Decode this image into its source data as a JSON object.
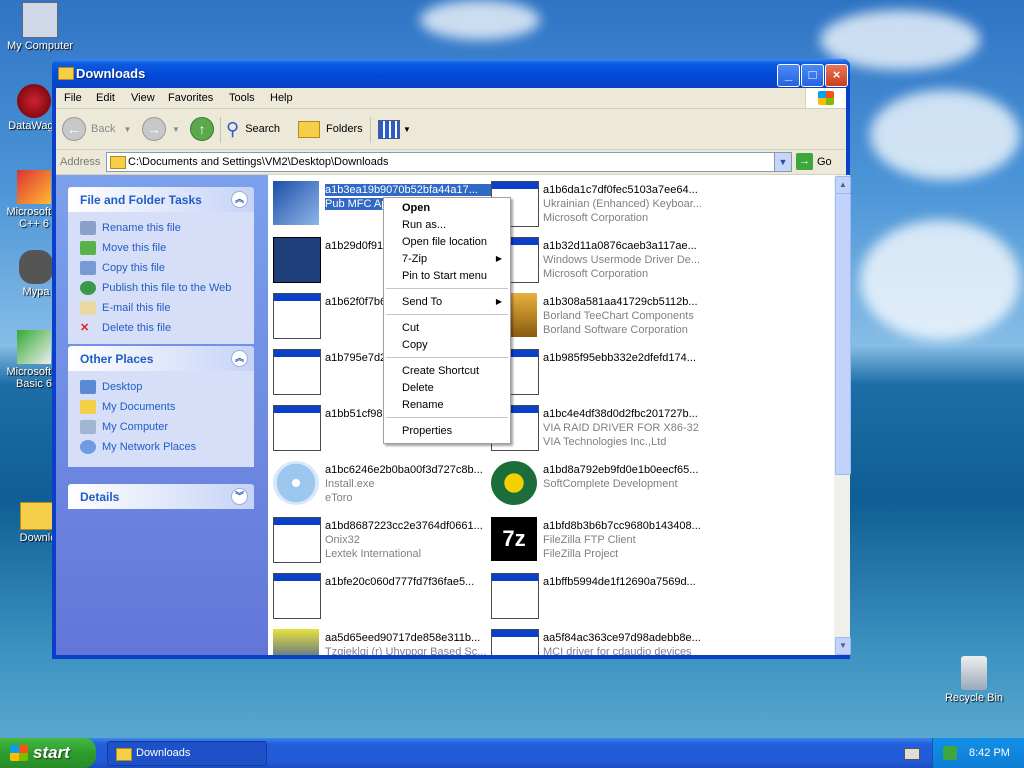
{
  "desktop": {
    "icons": [
      {
        "label": "My Computer"
      },
      {
        "label": "DataWago"
      },
      {
        "label": "Microsoft V\nC++ 6"
      },
      {
        "label": "Mypa"
      },
      {
        "label": "Microsoft V\nBasic 6"
      },
      {
        "label": "Downlo"
      },
      {
        "label": "Recycle Bin"
      }
    ]
  },
  "window": {
    "title": "Downloads",
    "controls": {
      "minimize": "_",
      "maximize": "□",
      "close": "×"
    }
  },
  "menubar": [
    "File",
    "Edit",
    "View",
    "Favorites",
    "Tools",
    "Help"
  ],
  "toolbar": {
    "back": "Back",
    "search": "Search",
    "folders": "Folders"
  },
  "addressbar": {
    "label": "Address",
    "path": "C:\\Documents and Settings\\VM2\\Desktop\\Downloads",
    "go": "Go"
  },
  "taskpane": {
    "file_tasks": {
      "title": "File and Folder Tasks",
      "links": [
        "Rename this file",
        "Move this file",
        "Copy this file",
        "Publish this file to the Web",
        "E-mail this file",
        "Delete this file"
      ]
    },
    "other_places": {
      "title": "Other Places",
      "links": [
        "Desktop",
        "My Documents",
        "My Computer",
        "My Network Places"
      ]
    },
    "details": {
      "title": "Details"
    }
  },
  "files": [
    {
      "name": "a1b3ea19b9070b52bfa44a17...",
      "desc": "Pub MFC Ap...",
      "company": ""
    },
    {
      "name": "a1b6da1c7df0fec5103a7ee64...",
      "desc": "Ukrainian (Enhanced) Keyboar...",
      "company": "Microsoft Corporation"
    },
    {
      "name": "a1b29d0f91f",
      "desc": "",
      "company": ""
    },
    {
      "name": "a1b32d11a0876caeb3a117ae...",
      "desc": "Windows Usermode Driver De...",
      "company": "Microsoft Corporation"
    },
    {
      "name": "a1b62f0f7b6",
      "desc": "",
      "company": ""
    },
    {
      "name": "a1b308a581aa41729cb5112b...",
      "desc": "Borland TeeChart Components",
      "company": "Borland Software Corporation"
    },
    {
      "name": "a1b795e7d2",
      "desc": "",
      "company": ""
    },
    {
      "name": "a1b985f95ebb332e2dfefd174...",
      "desc": "",
      "company": ""
    },
    {
      "name": "a1bb51cf989",
      "desc": "",
      "company": ""
    },
    {
      "name": "a1bc4e4df38d0d2fbc201727b...",
      "desc": "VIA RAID DRIVER FOR X86-32",
      "company": "VIA Technologies Inc.,Ltd"
    },
    {
      "name": "a1bc6246e2b0ba00f3d727c8b...",
      "desc": "Install.exe",
      "company": "eToro"
    },
    {
      "name": "a1bd8a792eb9fd0e1b0eecf65...",
      "desc": "SoftComplete Development",
      "company": ""
    },
    {
      "name": "a1bd8687223cc2e3764df0661...",
      "desc": "Onix32",
      "company": "Lextek International"
    },
    {
      "name": "a1bfd8b3b6b7cc9680b143408...",
      "desc": "FileZilla FTP Client",
      "company": "FileZilla Project"
    },
    {
      "name": "a1bfe20c060d777fd7f36fae5...",
      "desc": "",
      "company": ""
    },
    {
      "name": "a1bffb5994de1f12690a7569d...",
      "desc": "",
      "company": ""
    },
    {
      "name": "aa5d65eed90717de858e311b...",
      "desc": "Tzgieklgj (r) Uhyppgr Based Sc...",
      "company": ""
    },
    {
      "name": "aa5f84ac363ce97d98adebb8e...",
      "desc": "MCI driver for cdaudio devices",
      "company": ""
    }
  ],
  "context_menu": {
    "items": [
      "Open",
      "Run as...",
      "Open file location",
      "7-Zip",
      "Pin to Start menu",
      "Send To",
      "Cut",
      "Copy",
      "Create Shortcut",
      "Delete",
      "Rename",
      "Properties"
    ]
  },
  "taskbar": {
    "start": "start",
    "task": "Downloads",
    "clock": "8:42 PM"
  }
}
